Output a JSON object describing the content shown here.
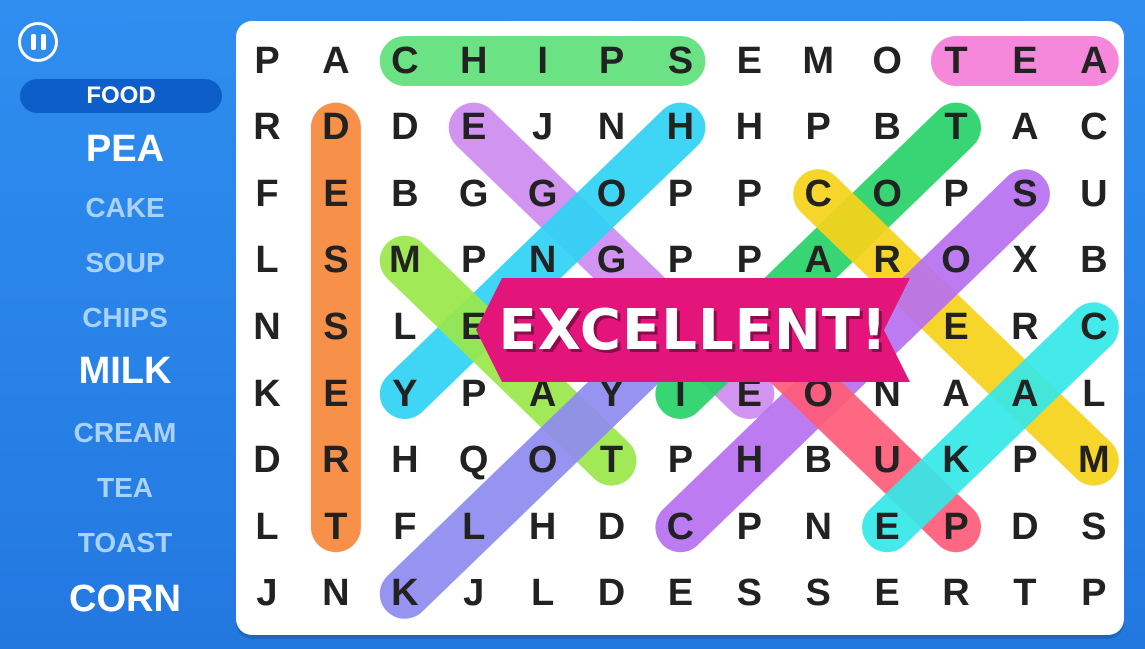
{
  "pause": {
    "icon": "pause-icon"
  },
  "category": "FOOD",
  "words": [
    {
      "text": "PEA",
      "found": false
    },
    {
      "text": "CAKE",
      "found": true
    },
    {
      "text": "SOUP",
      "found": true
    },
    {
      "text": "CHIPS",
      "found": true
    },
    {
      "text": "MILK",
      "found": false
    },
    {
      "text": "CREAM",
      "found": true
    },
    {
      "text": "TEA",
      "found": true
    },
    {
      "text": "TOAST",
      "found": true
    },
    {
      "text": "CORN",
      "found": false
    }
  ],
  "grid": [
    [
      "P",
      "A",
      "C",
      "H",
      "I",
      "P",
      "S",
      "E",
      "M",
      "O",
      "T",
      "E",
      "A"
    ],
    [
      "R",
      "D",
      "D",
      "E",
      "J",
      "N",
      "H",
      "H",
      "P",
      "B",
      "T",
      "A",
      "C"
    ],
    [
      "F",
      "E",
      "B",
      "G",
      "G",
      "O",
      "P",
      "P",
      "C",
      "O",
      "P",
      "S",
      "U"
    ],
    [
      "L",
      "S",
      "M",
      "P",
      "N",
      "G",
      "P",
      "P",
      "A",
      "R",
      "O",
      "X",
      "B"
    ],
    [
      "N",
      "S",
      "L",
      "E",
      "",
      "",
      "",
      "",
      "",
      "",
      "E",
      "R",
      "C"
    ],
    [
      "K",
      "E",
      "Y",
      "P",
      "A",
      "Y",
      "I",
      "E",
      "O",
      "N",
      "A",
      "A",
      "L"
    ],
    [
      "D",
      "R",
      "H",
      "Q",
      "O",
      "T",
      "P",
      "H",
      "B",
      "U",
      "K",
      "P",
      "M"
    ],
    [
      "L",
      "T",
      "F",
      "L",
      "H",
      "D",
      "C",
      "P",
      "N",
      "E",
      "P",
      "D",
      "S"
    ],
    [
      "J",
      "N",
      "K",
      "J",
      "L",
      "D",
      "E",
      "S",
      "S",
      "E",
      "R",
      "T",
      "P"
    ]
  ],
  "highlights": [
    {
      "color": "#5fe07a",
      "from": [
        0,
        2
      ],
      "to": [
        0,
        6
      ]
    },
    {
      "color": "#f57ed9",
      "from": [
        0,
        10
      ],
      "to": [
        0,
        12
      ]
    },
    {
      "color": "#f7883a",
      "from": [
        1,
        1
      ],
      "to": [
        7,
        1
      ]
    },
    {
      "color": "#cf8cf0",
      "from": [
        1,
        3
      ],
      "to": [
        5,
        7
      ]
    },
    {
      "color": "#2fd3f5",
      "from": [
        1,
        6
      ],
      "to": [
        5,
        2
      ]
    },
    {
      "color": "#28d26a",
      "from": [
        1,
        10
      ],
      "to": [
        5,
        6
      ]
    },
    {
      "color": "#f7d31a",
      "from": [
        2,
        8
      ],
      "to": [
        6,
        12
      ]
    },
    {
      "color": "#b870f0",
      "from": [
        2,
        11
      ],
      "to": [
        7,
        6
      ]
    },
    {
      "color": "#9be84a",
      "from": [
        3,
        2
      ],
      "to": [
        6,
        5
      ]
    },
    {
      "color": "#8f8bf0",
      "from": [
        8,
        2
      ],
      "to": [
        4,
        6
      ]
    },
    {
      "color": "#ff5c78",
      "from": [
        4,
        7
      ],
      "to": [
        7,
        10
      ]
    },
    {
      "color": "#35e8e8",
      "from": [
        4,
        12
      ],
      "to": [
        7,
        9
      ]
    }
  ],
  "banner": "EXCELLENT!"
}
